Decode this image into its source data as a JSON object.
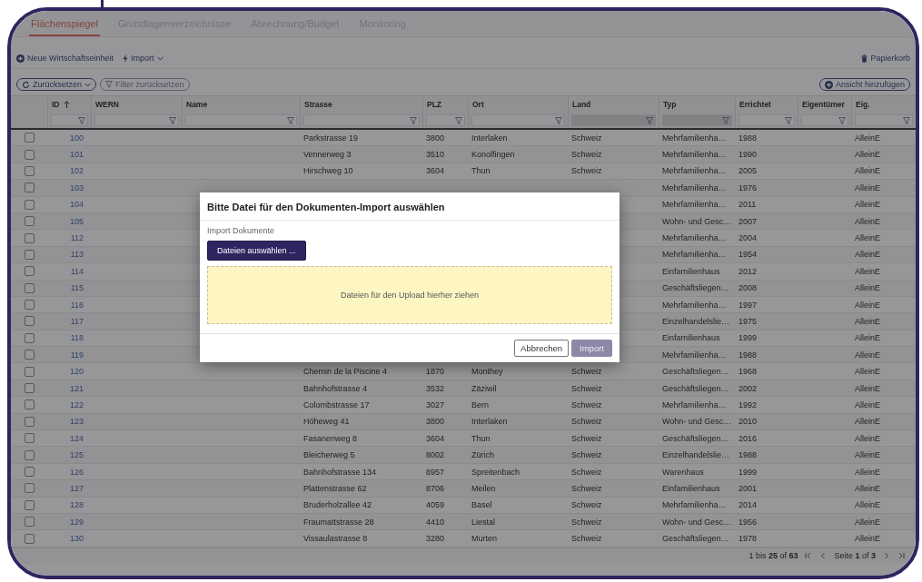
{
  "tabs": [
    {
      "label": "Flächenspiegel",
      "selected": true
    },
    {
      "label": "Grundlagenverzeichnisse",
      "selected": false
    },
    {
      "label": "Abrechnung/Budget",
      "selected": false
    },
    {
      "label": "Monitoring",
      "selected": false
    }
  ],
  "toolbar": {
    "new_button": "Neue Wirtschaftseinheit",
    "import_menu": "Import",
    "trash_link": "Papierkorb"
  },
  "view_bar": {
    "reset_button": "Zurücksetzen",
    "clear_filter_button": {
      "label": "Filter zurücksetzen",
      "disabled": true
    },
    "add_view_button": "Ansicht hinzufügen"
  },
  "table": {
    "columns": [
      {
        "label": "ID",
        "sorted": true,
        "kind": "text"
      },
      {
        "label": "WERN",
        "sorted": false,
        "kind": "text"
      },
      {
        "label": "Name",
        "sorted": false,
        "kind": "text"
      },
      {
        "label": "Strasse",
        "sorted": false,
        "kind": "text"
      },
      {
        "label": "PLZ",
        "sorted": false,
        "kind": "text"
      },
      {
        "label": "Ort",
        "sorted": false,
        "kind": "text"
      },
      {
        "label": "Land",
        "sorted": false,
        "kind": "select"
      },
      {
        "label": "Typ",
        "sorted": false,
        "kind": "select"
      },
      {
        "label": "Errichtet",
        "sorted": false,
        "kind": "text"
      },
      {
        "label": "Eigentümer",
        "sorted": false,
        "kind": "text"
      },
      {
        "label": "Eig.",
        "sorted": false,
        "kind": "text"
      }
    ],
    "rows": [
      {
        "checked": false,
        "cells": [
          "100",
          null,
          null,
          "Parkstrasse 19",
          "3800",
          "Interlaken",
          "Schweiz",
          "Mehrfamilienha…",
          "1988",
          null,
          "AlleinE"
        ]
      },
      {
        "checked": false,
        "cells": [
          "101",
          null,
          null,
          "Vennerweg 3",
          "3510",
          "Konolfingen",
          "Schweiz",
          "Mehrfamilienha…",
          "1990",
          null,
          "AlleinE"
        ]
      },
      {
        "checked": false,
        "cells": [
          "102",
          null,
          null,
          "Hirschweg 10",
          "3604",
          "Thun",
          "Schweiz",
          "Mehrfamilienha…",
          "2005",
          null,
          "AlleinE"
        ]
      },
      {
        "checked": false,
        "cells": [
          "103",
          null,
          null,
          null,
          null,
          null,
          null,
          "Mehrfamilienha…",
          "1976",
          null,
          "AlleinE"
        ]
      },
      {
        "checked": false,
        "cells": [
          "104",
          null,
          null,
          null,
          null,
          null,
          null,
          "Mehrfamilienha…",
          "2011",
          null,
          "AlleinE"
        ]
      },
      {
        "checked": false,
        "cells": [
          "105",
          null,
          null,
          null,
          null,
          null,
          null,
          "Wohn- und Gesc…",
          "2007",
          null,
          "AlleinE"
        ]
      },
      {
        "checked": false,
        "cells": [
          "112",
          null,
          null,
          null,
          null,
          null,
          null,
          "Mehrfamilienha…",
          "2004",
          null,
          "AlleinE"
        ]
      },
      {
        "checked": false,
        "cells": [
          "113",
          null,
          null,
          null,
          null,
          null,
          null,
          "Mehrfamilienha…",
          "1954",
          null,
          "AlleinE"
        ]
      },
      {
        "checked": false,
        "cells": [
          "114",
          null,
          null,
          null,
          null,
          null,
          null,
          "Einfamilienhaus",
          "2012",
          null,
          "AlleinE"
        ]
      },
      {
        "checked": false,
        "cells": [
          "115",
          null,
          null,
          null,
          null,
          null,
          null,
          "Geschäftsliegen…",
          "2008",
          null,
          "AlleinE"
        ]
      },
      {
        "checked": false,
        "cells": [
          "116",
          null,
          null,
          null,
          null,
          null,
          null,
          "Mehrfamilienha…",
          "1997",
          null,
          "AlleinE"
        ]
      },
      {
        "checked": false,
        "cells": [
          "117",
          null,
          null,
          null,
          null,
          null,
          null,
          "Einzelhandelslie…",
          "1975",
          null,
          "AlleinE"
        ]
      },
      {
        "checked": false,
        "cells": [
          "118",
          null,
          null,
          null,
          null,
          null,
          null,
          "Einfamilienhaus",
          "1999",
          null,
          "AlleinE"
        ]
      },
      {
        "checked": false,
        "cells": [
          "119",
          null,
          null,
          null,
          null,
          null,
          null,
          "Mehrfamilienha…",
          "1988",
          null,
          "AlleinE"
        ]
      },
      {
        "checked": false,
        "cells": [
          "120",
          null,
          null,
          "Chemin de la Piscine 4",
          "1870",
          "Monthey",
          "Schweiz",
          "Geschäftsliegen…",
          "1968",
          null,
          "AlleinE"
        ]
      },
      {
        "checked": false,
        "cells": [
          "121",
          null,
          null,
          "Bahnhofstrasse 4",
          "3532",
          "Zäziwil",
          "Schweiz",
          "Geschäftsliegen…",
          "2002",
          null,
          "AlleinE"
        ]
      },
      {
        "checked": false,
        "cells": [
          "122",
          null,
          null,
          "Colombstrasse 17",
          "3027",
          "Bern",
          "Schweiz",
          "Mehrfamilienha…",
          "1992",
          null,
          "AlleinE"
        ]
      },
      {
        "checked": false,
        "cells": [
          "123",
          null,
          null,
          "Höheweg 41",
          "3800",
          "Interlaken",
          "Schweiz",
          "Wohn- und Gesc…",
          "2010",
          null,
          "AlleinE"
        ]
      },
      {
        "checked": false,
        "cells": [
          "124",
          null,
          null,
          "Fasanenweg 8",
          "3604",
          "Thun",
          "Schweiz",
          "Geschäftsliegen…",
          "2016",
          null,
          "AlleinE"
        ]
      },
      {
        "checked": false,
        "cells": [
          "125",
          null,
          null,
          "Bleicherweg 5",
          "8002",
          "Zürich",
          "Schweiz",
          "Einzelhandelslie…",
          "1988",
          null,
          "AlleinE"
        ]
      },
      {
        "checked": false,
        "cells": [
          "126",
          null,
          null,
          "Bahnhofstrasse 134",
          "8957",
          "Spreitenbach",
          "Schweiz",
          "Warenhaus",
          "1999",
          null,
          "AlleinE"
        ]
      },
      {
        "checked": false,
        "cells": [
          "127",
          null,
          null,
          "Plattenstrasse 62",
          "8706",
          "Meilen",
          "Schweiz",
          "Einfamilienhaus",
          "2001",
          null,
          "AlleinE"
        ]
      },
      {
        "checked": false,
        "cells": [
          "128",
          null,
          null,
          "Bruderholzallee 42",
          "4059",
          "Basel",
          "Schweiz",
          "Mehrfamilienha…",
          "2014",
          null,
          "AlleinE"
        ]
      },
      {
        "checked": false,
        "cells": [
          "129",
          null,
          null,
          "Fraumattstrasse 28",
          "4410",
          "Liestal",
          "Schweiz",
          "Wohn- und Gesc…",
          "1956",
          null,
          "AlleinE"
        ]
      },
      {
        "checked": false,
        "cells": [
          "130",
          null,
          null,
          "Vissaulastrasse 8",
          "3280",
          "Murten",
          "Schweiz",
          "Geschäftsliegen…",
          "1978",
          null,
          "AlleinE"
        ]
      }
    ]
  },
  "pagination": {
    "range": "1 bis **25** of **63**",
    "page": "Seite **1** of **3**"
  },
  "dialog": {
    "title": "Bitte Datei für den Dokumenten-Import auswählen",
    "field_label": "Import Dokumente",
    "choose_button": "Dateien auswählen ...",
    "dropzone": "Dateien für den Upload hierher ziehen",
    "cancel_button": "Abbrechen",
    "import_button": {
      "label": "Import",
      "disabled": true
    }
  }
}
